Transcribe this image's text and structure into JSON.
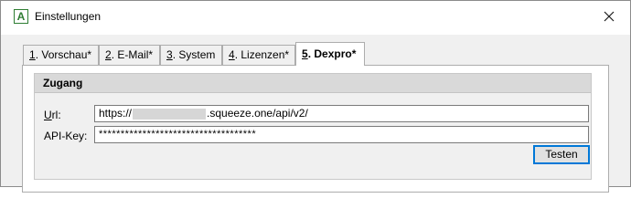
{
  "window": {
    "title": "Einstellungen",
    "app_icon_letter": "A"
  },
  "tabs": [
    {
      "num": "1",
      "label": ". Vorschau*",
      "active": false
    },
    {
      "num": "2",
      "label": ". E-Mail*",
      "active": false
    },
    {
      "num": "3",
      "label": ". System",
      "active": false
    },
    {
      "num": "4",
      "label": ". Lizenzen*",
      "active": false
    },
    {
      "num": "5",
      "label": ". Dexpro*",
      "active": true
    }
  ],
  "group": {
    "title": "Zugang"
  },
  "fields": {
    "url_label_mnemonic": "U",
    "url_label_rest": "rl:",
    "url_prefix": "https://",
    "url_suffix": ".squeeze.one/api/v2/",
    "apikey_label": "API-Key:",
    "apikey_value": "************************************"
  },
  "buttons": {
    "test_label": "Testen"
  }
}
